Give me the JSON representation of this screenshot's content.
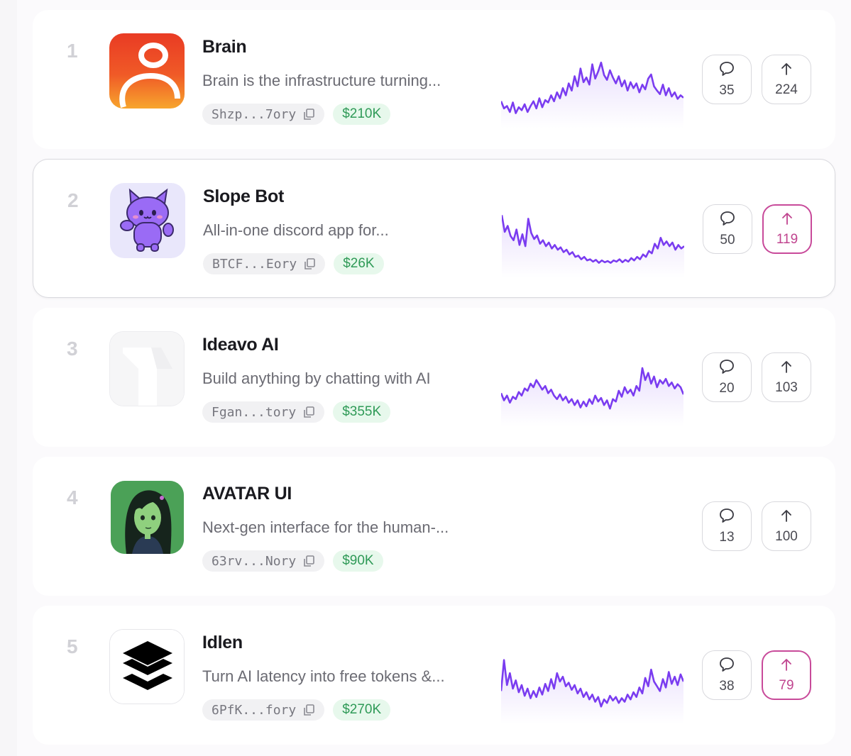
{
  "projects": [
    {
      "rank": "1",
      "name": "Brain",
      "description": "Brain is the infrastructure turning...",
      "address": "Shzp...7ory",
      "market_cap": "$210K",
      "comments": "35",
      "upvotes": "224",
      "upvoted": false,
      "logo": "brain-logo-icon",
      "sparkline": [
        0.3,
        0.18,
        0.22,
        0.12,
        0.28,
        0.1,
        0.2,
        0.15,
        0.25,
        0.12,
        0.22,
        0.3,
        0.18,
        0.35,
        0.2,
        0.32,
        0.28,
        0.4,
        0.3,
        0.45,
        0.35,
        0.52,
        0.4,
        0.6,
        0.48,
        0.72,
        0.55,
        0.85,
        0.62,
        0.7,
        0.58,
        0.92,
        0.68,
        0.8,
        0.95,
        0.74,
        0.66,
        0.82,
        0.7,
        0.6,
        0.72,
        0.55,
        0.65,
        0.48,
        0.62,
        0.52,
        0.6,
        0.45,
        0.58,
        0.5,
        0.68,
        0.75,
        0.55,
        0.48,
        0.42,
        0.58,
        0.4,
        0.52,
        0.38,
        0.45,
        0.34,
        0.4,
        0.36
      ]
    },
    {
      "rank": "2",
      "name": "Slope Bot",
      "description": "All-in-one discord app for...",
      "address": "BTCF...Eory",
      "market_cap": "$26K",
      "comments": "50",
      "upvotes": "119",
      "upvoted": true,
      "logo": "cat-mascot-icon",
      "sparkline": [
        0.9,
        0.62,
        0.72,
        0.55,
        0.48,
        0.66,
        0.4,
        0.58,
        0.38,
        0.84,
        0.6,
        0.5,
        0.56,
        0.42,
        0.48,
        0.38,
        0.44,
        0.34,
        0.4,
        0.32,
        0.36,
        0.28,
        0.32,
        0.24,
        0.28,
        0.2,
        0.22,
        0.16,
        0.2,
        0.14,
        0.16,
        0.12,
        0.15,
        0.1,
        0.14,
        0.11,
        0.13,
        0.1,
        0.14,
        0.12,
        0.16,
        0.11,
        0.15,
        0.12,
        0.18,
        0.14,
        0.2,
        0.16,
        0.24,
        0.2,
        0.3,
        0.26,
        0.42,
        0.34,
        0.52,
        0.4,
        0.46,
        0.38,
        0.44,
        0.32,
        0.4,
        0.34,
        0.38
      ]
    },
    {
      "rank": "3",
      "name": "Ideavo AI",
      "description": "Build anything by chatting with AI",
      "address": "Fgan...tory",
      "market_cap": "$355K",
      "comments": "20",
      "upvotes": "103",
      "upvoted": false,
      "logo": "ideavo-logo-icon",
      "sparkline": [
        0.4,
        0.28,
        0.36,
        0.24,
        0.34,
        0.3,
        0.42,
        0.36,
        0.48,
        0.44,
        0.56,
        0.5,
        0.62,
        0.54,
        0.46,
        0.52,
        0.4,
        0.46,
        0.36,
        0.3,
        0.38,
        0.28,
        0.34,
        0.24,
        0.3,
        0.2,
        0.28,
        0.16,
        0.26,
        0.18,
        0.3,
        0.22,
        0.36,
        0.26,
        0.32,
        0.2,
        0.28,
        0.14,
        0.3,
        0.26,
        0.44,
        0.34,
        0.5,
        0.4,
        0.46,
        0.36,
        0.52,
        0.44,
        0.82,
        0.62,
        0.74,
        0.56,
        0.68,
        0.5,
        0.62,
        0.56,
        0.64,
        0.52,
        0.58,
        0.48,
        0.55,
        0.5,
        0.38
      ]
    },
    {
      "rank": "4",
      "name": "AVATAR UI",
      "description": "Next-gen interface for the human-...",
      "address": "63rv...Nory",
      "market_cap": "$90K",
      "comments": "13",
      "upvotes": "100",
      "upvoted": false,
      "logo": "avatar-portrait-icon",
      "sparkline": []
    },
    {
      "rank": "5",
      "name": "Idlen",
      "description": "Turn AI latency into free tokens &...",
      "address": "6PfK...fory",
      "market_cap": "$270K",
      "comments": "38",
      "upvotes": "79",
      "upvoted": true,
      "logo": "layers-stack-icon",
      "sparkline": [
        0.4,
        0.92,
        0.5,
        0.7,
        0.44,
        0.58,
        0.38,
        0.5,
        0.32,
        0.44,
        0.28,
        0.4,
        0.3,
        0.46,
        0.34,
        0.52,
        0.4,
        0.6,
        0.44,
        0.7,
        0.56,
        0.64,
        0.48,
        0.54,
        0.42,
        0.5,
        0.36,
        0.44,
        0.3,
        0.38,
        0.26,
        0.34,
        0.22,
        0.3,
        0.14,
        0.26,
        0.2,
        0.32,
        0.24,
        0.3,
        0.2,
        0.28,
        0.22,
        0.34,
        0.26,
        0.38,
        0.3,
        0.46,
        0.36,
        0.62,
        0.48,
        0.76,
        0.56,
        0.48,
        0.4,
        0.6,
        0.46,
        0.72,
        0.52,
        0.64,
        0.5,
        0.68,
        0.56
      ]
    }
  ],
  "colors": {
    "sparkline": "#7a3cf0",
    "upvoted": "#c84a9a",
    "market_cap_bg": "#e7f8ec",
    "market_cap_text": "#2f9a57"
  }
}
